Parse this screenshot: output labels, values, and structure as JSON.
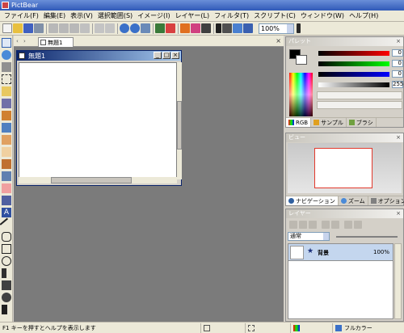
{
  "app": {
    "title": "PictBear"
  },
  "menu": [
    "ファイル(F)",
    "編集(E)",
    "表示(V)",
    "選択範囲(S)",
    "イメージ(I)",
    "レイヤー(L)",
    "フィルタ(T)",
    "スクリプト(C)",
    "ウィンドウ(W)",
    "ヘルプ(H)"
  ],
  "toolbar": {
    "zoom": "100%"
  },
  "document": {
    "tab_label": "無題1",
    "window_title": "無題1"
  },
  "palette": {
    "title": "パレット",
    "values": {
      "r": "0",
      "g": "0",
      "b": "0",
      "a": "255"
    },
    "tabs": [
      "RGB",
      "サンプル",
      "ブラシ"
    ]
  },
  "view": {
    "title": "ビュー",
    "tabs": [
      "ナビゲーション",
      "ズーム",
      "オプション"
    ]
  },
  "layers": {
    "title": "レイヤー",
    "blend_mode": "通常",
    "items": [
      {
        "name": "背景",
        "opacity": "100%"
      }
    ]
  },
  "statusbar": {
    "message": "F1 キーを押すとヘルプを表示します",
    "color_mode": "フルカラー"
  },
  "colors": {
    "accent": "#0a246a",
    "selection": "#c4d6ee",
    "workspace": "#7b7b7b"
  }
}
